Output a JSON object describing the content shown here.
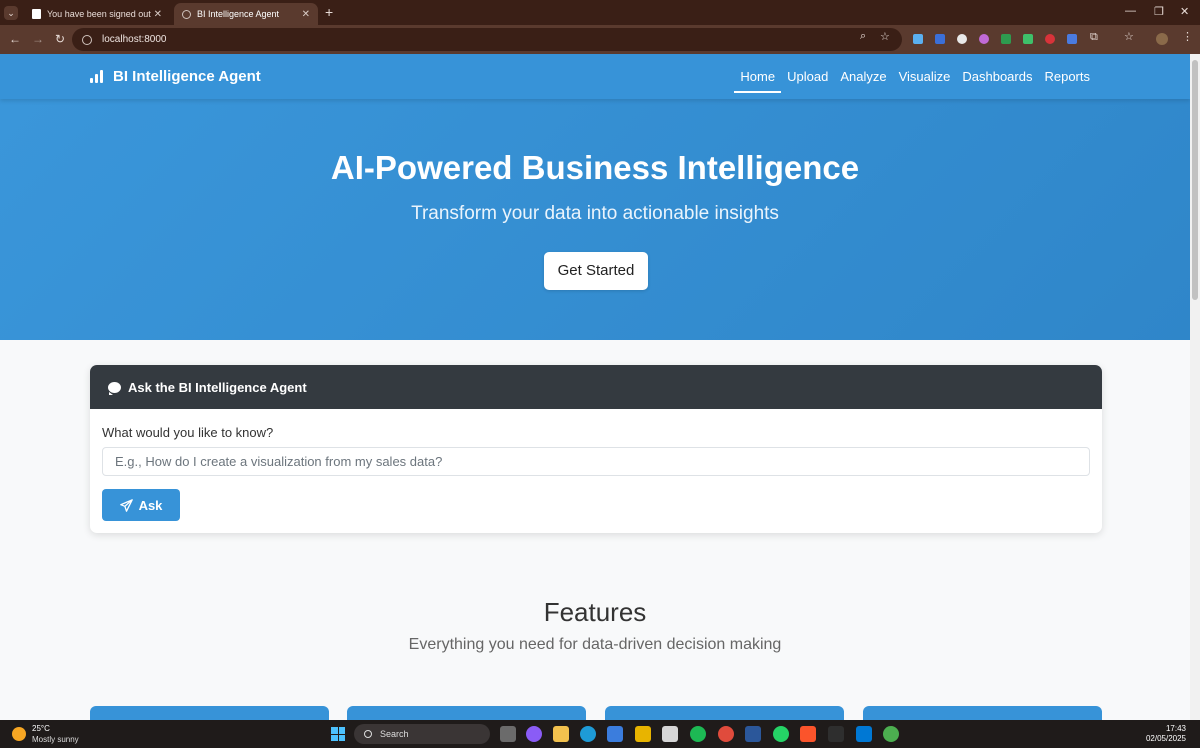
{
  "browser": {
    "tabs": [
      {
        "title": "You have been signed out"
      },
      {
        "title": "BI Intelligence Agent"
      }
    ],
    "url": "localhost:8000"
  },
  "navbar": {
    "brand": "BI Intelligence Agent",
    "links": [
      "Home",
      "Upload",
      "Analyze",
      "Visualize",
      "Dashboards",
      "Reports"
    ],
    "active": "Home"
  },
  "hero": {
    "title": "AI-Powered Business Intelligence",
    "subtitle": "Transform your data into actionable insights",
    "cta": "Get Started"
  },
  "ask": {
    "header": "Ask the BI Intelligence Agent",
    "label": "What would you like to know?",
    "placeholder": "E.g., How do I create a visualization from my sales data?",
    "button": "Ask"
  },
  "features": {
    "title": "Features",
    "subtitle": "Everything you need for data-driven decision making"
  },
  "taskbar": {
    "weather_temp": "25°C",
    "weather_desc": "Mostly sunny",
    "search": "Search",
    "time": "17:43",
    "date": "02/05/2025"
  },
  "colors": {
    "primary": "#3793d8",
    "dark_header": "#343a40",
    "browser_frame": "#5a3a2e"
  }
}
